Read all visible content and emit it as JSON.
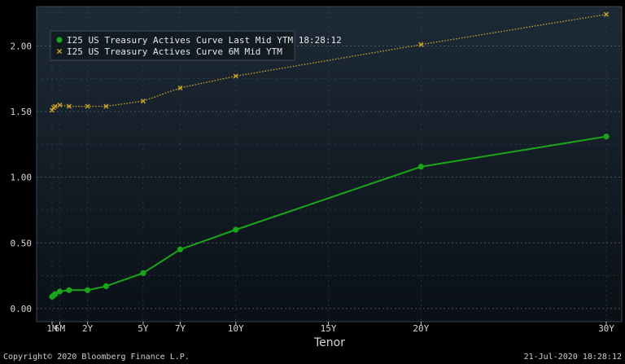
{
  "chart_data": {
    "type": "line",
    "title": "",
    "xlabel": "Tenor",
    "ylabel": "",
    "x_tick_labels": [
      "1M",
      "6M",
      "2Y",
      "5Y",
      "7Y",
      "10Y",
      "15Y",
      "20Y",
      "30Y"
    ],
    "x_tick_years": [
      0.0833,
      0.5,
      2,
      5,
      7,
      10,
      15,
      20,
      30
    ],
    "y_ticks": [
      "0.00",
      "0.50",
      "1.00",
      "1.50",
      "2.00"
    ],
    "ylim": [
      -0.1,
      2.3
    ],
    "grid": true,
    "legend_position": "top-left",
    "series": [
      {
        "name": "I25 US Treasury Actives Curve Last Mid YTM 18:28:12",
        "color": "#1aa51a",
        "marker": "circle",
        "style": "solid",
        "x": [
          "1M",
          "2M",
          "3M",
          "6M",
          "1Y",
          "2Y",
          "3Y",
          "5Y",
          "7Y",
          "10Y",
          "20Y",
          "30Y"
        ],
        "values": [
          0.09,
          0.1,
          0.11,
          0.13,
          0.14,
          0.14,
          0.17,
          0.27,
          0.45,
          0.6,
          1.08,
          1.31
        ]
      },
      {
        "name": "I25 US Treasury Actives Curve 6M Mid YTM",
        "color": "#c9a227",
        "marker": "x",
        "style": "dotted",
        "x": [
          "1M",
          "2M",
          "3M",
          "6M",
          "1Y",
          "2Y",
          "3Y",
          "5Y",
          "7Y",
          "10Y",
          "20Y",
          "30Y"
        ],
        "values": [
          1.51,
          1.53,
          1.54,
          1.55,
          1.54,
          1.54,
          1.54,
          1.58,
          1.68,
          1.77,
          2.01,
          2.24
        ]
      }
    ]
  },
  "footer": {
    "copyright": "Copyright© 2020 Bloomberg Finance L.P.",
    "timestamp": "21-Jul-2020 18:28:12"
  }
}
